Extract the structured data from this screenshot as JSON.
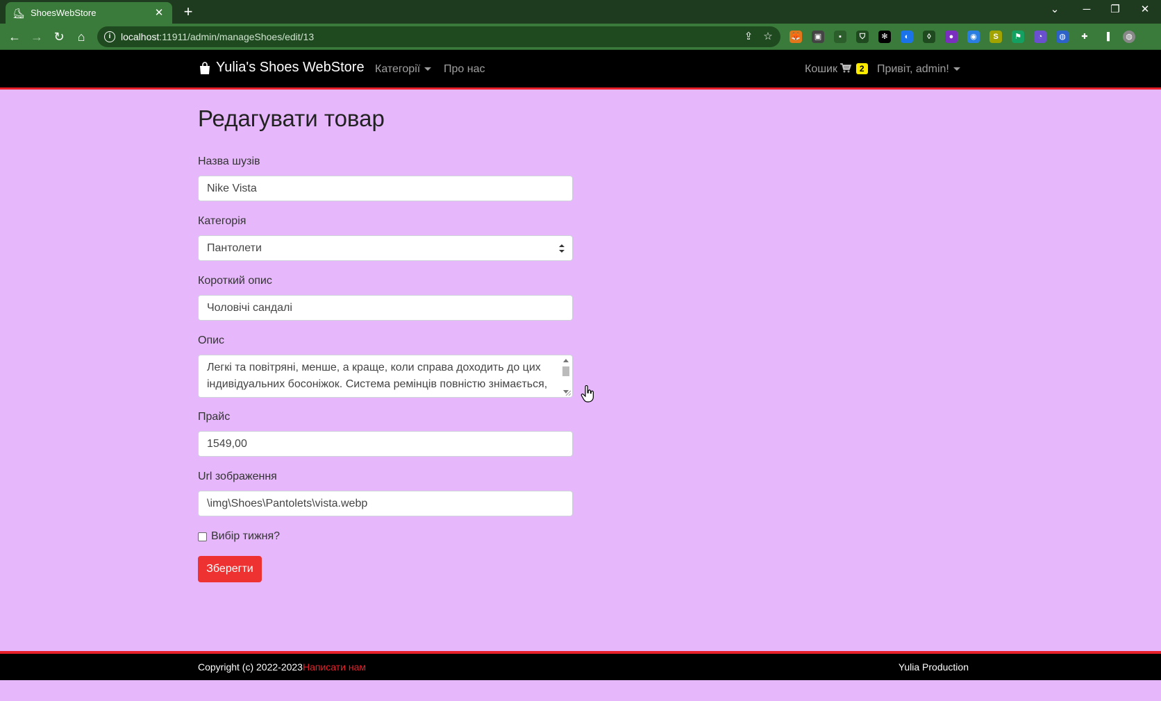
{
  "browser": {
    "tab_title": "ShoesWebStore",
    "url_host": "localhost",
    "url_path": ":11911/admin/manageShoes/edit/13",
    "extensions": [
      {
        "name": "metamask-icon",
        "color": "#e2761b",
        "glyph": "🦊"
      },
      {
        "name": "extension-icon",
        "color": "#444444",
        "glyph": "▣"
      },
      {
        "name": "extension-icon",
        "color": "#2b5e2b",
        "glyph": "▪"
      },
      {
        "name": "shield-icon",
        "color": "#1f4a1f",
        "glyph": "⛉"
      },
      {
        "name": "extension-icon",
        "color": "#000000",
        "glyph": "✻"
      },
      {
        "name": "extension-icon",
        "color": "#1a73e8",
        "glyph": "◐"
      },
      {
        "name": "drop-icon",
        "color": "#1f4a1f",
        "glyph": "◊"
      },
      {
        "name": "extension-icon",
        "color": "#7b2fbf",
        "glyph": "●"
      },
      {
        "name": "extension-icon",
        "color": "#2a7de1",
        "glyph": "◉"
      },
      {
        "name": "extension-icon",
        "color": "#a3a300",
        "glyph": "S"
      },
      {
        "name": "extension-icon",
        "color": "#14a060",
        "glyph": "⚑"
      },
      {
        "name": "extension-icon",
        "color": "#6a4fcf",
        "glyph": "◔"
      },
      {
        "name": "extension-icon",
        "color": "#2d63c8",
        "glyph": "◍"
      },
      {
        "name": "puzzle-icon",
        "color": "#3a7a3a",
        "glyph": "✚"
      },
      {
        "name": "sidepanel-icon",
        "color": "#3a7a3a",
        "glyph": "▐"
      },
      {
        "name": "avatar",
        "color": "#888888",
        "glyph": "◍"
      }
    ]
  },
  "nav": {
    "brand": "Yulia's Shoes WebStore",
    "categories": "Категорії",
    "about": "Про нас",
    "cart_label": "Кошик",
    "cart_count": "2",
    "user_greeting": "Привіт, admin!"
  },
  "form": {
    "title": "Редагувати товар",
    "name_label": "Назва шузів",
    "name_value": "Nike Vista",
    "category_label": "Категорія",
    "category_value": "Пантолети",
    "short_label": "Короткий опис",
    "short_value": "Чоловічі сандалі",
    "desc_label": "Опис",
    "desc_value": "Легкі та повітряні, менше, а краще, коли справа доходить до цих індивідуальних босоніжок. Система ремінців повністю знімається,",
    "price_label": "Прайс",
    "price_value": "1549,00",
    "image_label": "Url зображення",
    "image_value": "\\img\\Shoes\\Pantolets\\vista.webp",
    "week_choice_label": "Вибір тижня?",
    "week_choice_checked": false,
    "save_label": "Зберегти"
  },
  "footer": {
    "copyright": "Copyright (c) 2022-2023",
    "contact": "Написати нам",
    "production": "Yulia Production"
  }
}
